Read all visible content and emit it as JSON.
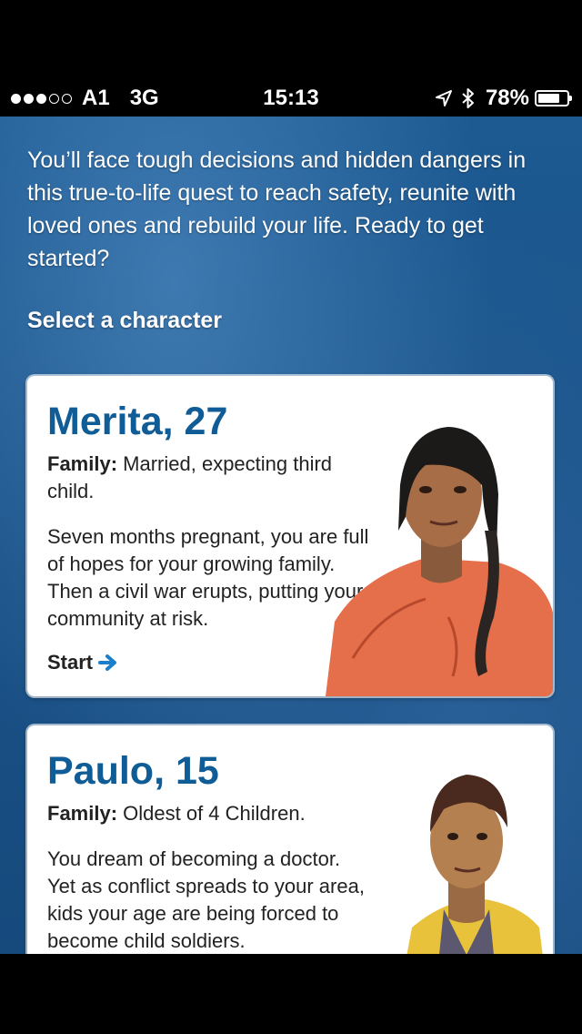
{
  "status_bar": {
    "carrier": "A1",
    "network": "3G",
    "time": "15:13",
    "battery": "78%",
    "battery_level": 0.78,
    "signal_dots_filled": 3,
    "signal_dots_total": 5
  },
  "intro": {
    "text": "You’ll face tough decisions and hidden dangers in this true-to-life quest to reach safety, reunite with loved ones and rebuild your life. Ready to get started?"
  },
  "section_title": "Select a character",
  "characters": [
    {
      "name": "Merita, 27",
      "family_label": "Family:",
      "family": "Married, expecting third child.",
      "description": "Seven months pregnant, you are full of hopes for your growing family. Then a civil war erupts, putting your community at risk.",
      "start_label": "Start"
    },
    {
      "name": "Paulo, 15",
      "family_label": "Family:",
      "family": "Oldest of 4 Children.",
      "description": "You dream of becoming a doctor. Yet as conflict spreads to your area, kids your age are being forced to become child soldiers."
    }
  ],
  "colors": {
    "accent": "#0f5c96",
    "background": "#1a5288",
    "arrow": "#1d7fc9"
  }
}
